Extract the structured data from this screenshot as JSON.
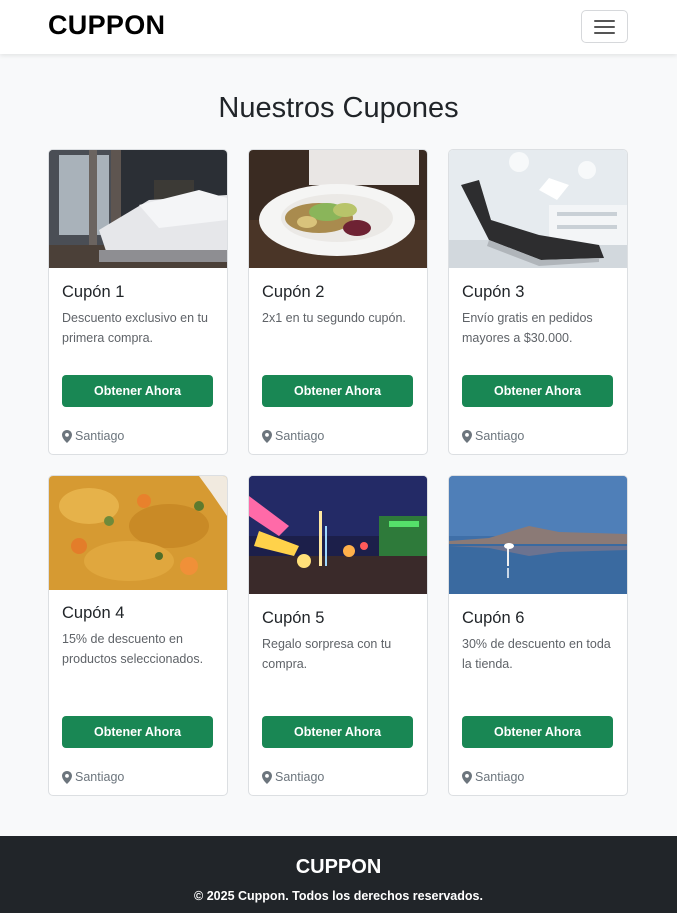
{
  "navbar": {
    "brand": "CUPPON",
    "toggle_icon": "hamburger-menu-icon"
  },
  "main": {
    "title": "Nuestros Cupones"
  },
  "cards": [
    {
      "title": "Cupón 1",
      "description": "Descuento exclusivo en tu primera compra.",
      "button": "Obtener Ahora",
      "location": "Santiago",
      "image": "bedroom-photo"
    },
    {
      "title": "Cupón 2",
      "description": "2x1 en tu segundo cupón.",
      "button": "Obtener Ahora",
      "location": "Santiago",
      "image": "salad-plate-photo"
    },
    {
      "title": "Cupón 3",
      "description": "Envío gratis en pedidos mayores a $30.000.",
      "button": "Obtener Ahora",
      "location": "Santiago",
      "image": "dental-chair-photo"
    },
    {
      "title": "Cupón 4",
      "description": "15% de descuento en productos seleccionados.",
      "button": "Obtener Ahora",
      "location": "Santiago",
      "image": "vegetable-stew-photo"
    },
    {
      "title": "Cupón 5",
      "description": "Regalo sorpresa con tu compra.",
      "button": "Obtener Ahora",
      "location": "Santiago",
      "image": "night-fair-photo"
    },
    {
      "title": "Cupón 6",
      "description": "30% de descuento en toda la tienda.",
      "button": "Obtener Ahora",
      "location": "Santiago",
      "image": "salt-lake-flamingo-photo"
    }
  ],
  "footer": {
    "brand": "CUPPON",
    "copyright": "© 2025 Cuppon. Todos los derechos reservados."
  },
  "colors": {
    "button": "#198754",
    "footer_bg": "#212529",
    "page_bg": "#f8f9fa"
  }
}
